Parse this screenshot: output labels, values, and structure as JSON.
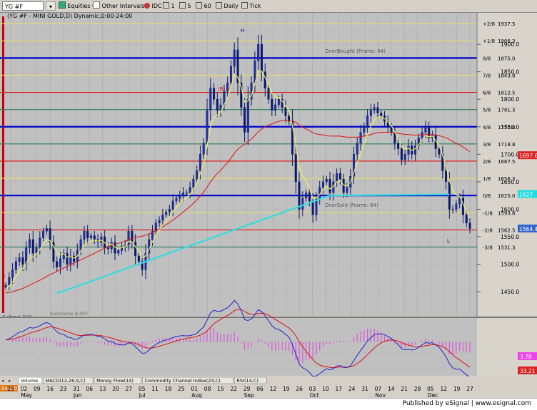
{
  "toolbar": {
    "symbol": "YG #F",
    "equities": "Equities",
    "intervals": "Other Intervals",
    "idc": "IDC",
    "interval_buttons": [
      "1",
      "5",
      "60",
      "Daily",
      "Tick"
    ]
  },
  "chart": {
    "header_title": "(YG #F - MINI GOLD,D) Dynamic,0:00-24:00",
    "copyright": "© eSignal, 2010",
    "autoframe": "AutoFrame is OFF",
    "frame_label_upper": "OverBought (Frame: 64)",
    "frame_label_lower": "OverSold (Frame: 64)",
    "pivot_labels": [
      {
        "text": "(R)",
        "color": "#cc0000"
      },
      {
        "text": "H",
        "color": "#000080"
      },
      {
        "text": "L",
        "color": "#000080"
      },
      {
        "text": "2",
        "color": "#cc0000"
      }
    ],
    "date_box": "04/12/11",
    "published": "Published by eSignal | www.esignal.com"
  },
  "murrey_levels": [
    {
      "label": "+2/8",
      "price": 1937.5,
      "color": "#e8e060"
    },
    {
      "label": "+1/8",
      "price": 1906.3,
      "color": "#e8e060"
    },
    {
      "label": "8/8",
      "price": 1875.0,
      "color": "#0000cc"
    },
    {
      "label": "7/8",
      "price": 1843.8,
      "color": "#e8e060"
    },
    {
      "label": "6/8",
      "price": 1812.5,
      "color": "#dd1111"
    },
    {
      "label": "5/8",
      "price": 1781.3,
      "color": "#2e7d5a"
    },
    {
      "label": "4/8",
      "price": 1750.0,
      "color": "#0000cc"
    },
    {
      "label": "3/8",
      "price": 1718.8,
      "color": "#2e7d5a"
    },
    {
      "label": "2/8",
      "price": 1687.5,
      "color": "#dd1111"
    },
    {
      "label": "1/8",
      "price": 1656.3,
      "color": "#e8e060"
    },
    {
      "label": "0/8",
      "price": 1625.0,
      "color": "#0000cc"
    },
    {
      "label": "-1/8",
      "price": 1593.8,
      "color": "#e8e060"
    },
    {
      "label": "-2/8",
      "price": 1562.5,
      "color": "#dd1111"
    },
    {
      "label": "-3/8",
      "price": 1531.3,
      "color": "#2e7d5a"
    }
  ],
  "price_axis": [
    "1900.0",
    "1850.0",
    "1800.0",
    "1750.0",
    "1700.0",
    "1650.0",
    "1600.0",
    "1550.0",
    "1500.0",
    "1450.0"
  ],
  "current_price_tags": [
    {
      "text": "1697.6",
      "color": "#dd2222"
    },
    {
      "text": "1627",
      "color": "#22dddd"
    },
    {
      "text": "1564.4",
      "color": "#3366cc"
    }
  ],
  "macd_tags": [
    {
      "text": "3.78",
      "color": "#ee44ee"
    },
    {
      "text": "33.21",
      "color": "#dd2222"
    }
  ],
  "tabs": [
    "Volume",
    "MACD(12,26,9,C)",
    "Money Flow(14)",
    "Commodity Channel Index(23,C)",
    "RSI(14,C)"
  ],
  "chart_data": {
    "type": "candlestick",
    "title": "(YG #F - MINI GOLD,D) Dynamic,0:00-24:00",
    "ylim": [
      1410,
      1952
    ],
    "x_ticks": [
      "25",
      "02",
      "09",
      "16",
      "23",
      "31",
      "06",
      "13",
      "20",
      "27",
      "05",
      "11",
      "18",
      "25",
      "01",
      "08",
      "15",
      "22",
      "29",
      "06",
      "12",
      "19",
      "26",
      "03",
      "10",
      "17",
      "24",
      "31",
      "07",
      "14",
      "21",
      "28",
      "05",
      "12",
      "19",
      "27"
    ],
    "months": [
      "May",
      "Jun",
      "Jul",
      "Aug",
      "Sep",
      "Oct",
      "Nov",
      "Dec"
    ],
    "closes": [
      1462,
      1476,
      1490,
      1505,
      1512,
      1500,
      1530,
      1545,
      1520,
      1530,
      1548,
      1560,
      1565,
      1540,
      1505,
      1495,
      1510,
      1520,
      1500,
      1515,
      1505,
      1525,
      1545,
      1560,
      1548,
      1552,
      1545,
      1540,
      1550,
      1530,
      1528,
      1540,
      1520,
      1525,
      1532,
      1535,
      1560,
      1540,
      1515,
      1505,
      1490,
      1520,
      1545,
      1560,
      1575,
      1580,
      1590,
      1595,
      1600,
      1615,
      1620,
      1625,
      1630,
      1630,
      1640,
      1655,
      1670,
      1700,
      1720,
      1780,
      1820,
      1800,
      1780,
      1790,
      1815,
      1830,
      1860,
      1890,
      1830,
      1785,
      1740,
      1800,
      1830,
      1870,
      1900,
      1850,
      1820,
      1800,
      1780,
      1790,
      1800,
      1785,
      1770,
      1760,
      1700,
      1650,
      1600,
      1620,
      1630,
      1615,
      1590,
      1620,
      1640,
      1650,
      1655,
      1630,
      1650,
      1665,
      1655,
      1630,
      1640,
      1660,
      1700,
      1720,
      1740,
      1750,
      1770,
      1780,
      1785,
      1775,
      1770,
      1760,
      1750,
      1740,
      1720,
      1710,
      1690,
      1700,
      1715,
      1700,
      1715,
      1730,
      1740,
      1750,
      1730,
      1735,
      1710,
      1700,
      1670,
      1650,
      1600,
      1600,
      1610,
      1620,
      1590,
      1575,
      1565
    ],
    "ema_red": [
      1448,
      1449,
      1450,
      1452,
      1454,
      1456,
      1459,
      1462,
      1465,
      1468,
      1471,
      1474,
      1478,
      1481,
      1484,
      1487,
      1490,
      1493,
      1496,
      1499,
      1502,
      1505,
      1508,
      1511,
      1514,
      1517,
      1520,
      1523,
      1526,
      1529,
      1532,
      1534,
      1536,
      1538,
      1540,
      1542,
      1545,
      1547,
      1549,
      1550,
      1551,
      1553,
      1555,
      1558,
      1561,
      1564,
      1568,
      1572,
      1576,
      1580,
      1585,
      1590,
      1595,
      1600,
      1605,
      1611,
      1617,
      1624,
      1631,
      1640,
      1650,
      1658,
      1665,
      1671,
      1678,
      1685,
      1693,
      1702,
      1709,
      1714,
      1718,
      1723,
      1728,
      1734,
      1741,
      1746,
      1750,
      1753,
      1755,
      1758,
      1760,
      1761,
      1762,
      1762,
      1761,
      1758,
      1753,
      1749,
      1746,
      1743,
      1739,
      1737,
      1736,
      1735,
      1734,
      1733,
      1733,
      1733,
      1733,
      1732,
      1731,
      1731,
      1731,
      1731,
      1732,
      1733,
      1734,
      1736,
      1738,
      1739,
      1740,
      1740,
      1740,
      1740,
      1739,
      1738,
      1737,
      1736,
      1736,
      1735,
      1735,
      1735,
      1735,
      1736,
      1736,
      1736,
      1735,
      1734,
      1732,
      1730,
      1727,
      1723,
      1720,
      1717,
      1713,
      1709,
      1705
    ],
    "ema_yellow": [
      1455,
      1460,
      1468,
      1478,
      1488,
      1492,
      1502,
      1512,
      1513,
      1518,
      1527,
      1537,
      1545,
      1543,
      1532,
      1522,
      1518,
      1519,
      1513,
      1514,
      1511,
      1515,
      1524,
      1535,
      1539,
      1543,
      1544,
      1542,
      1544,
      1539,
      1535,
      1537,
      1531,
      1529,
      1530,
      1532,
      1542,
      1541,
      1532,
      1523,
      1512,
      1515,
      1527,
      1541,
      1553,
      1562,
      1571,
      1579,
      1586,
      1596,
      1604,
      1611,
      1617,
      1621,
      1627,
      1636,
      1647,
      1665,
      1683,
      1715,
      1750,
      1767,
      1771,
      1777,
      1790,
      1803,
      1822,
      1845,
      1840,
      1822,
      1795,
      1797,
      1807,
      1828,
      1852,
      1851,
      1840,
      1827,
      1811,
      1804,
      1803,
      1797,
      1788,
      1779,
      1752,
      1716,
      1677,
      1660,
      1651,
      1638,
      1620,
      1620,
      1627,
      1635,
      1642,
      1637,
      1641,
      1650,
      1652,
      1644,
      1643,
      1649,
      1667,
      1685,
      1703,
      1719,
      1737,
      1751,
      1763,
      1767,
      1768,
      1765,
      1759,
      1752,
      1740,
      1729,
      1714,
      1709,
      1711,
      1707,
      1710,
      1717,
      1725,
      1734,
      1732,
      1733,
      1725,
      1716,
      1698,
      1680,
      1652,
      1634,
      1626,
      1624,
      1610,
      1596,
      1584
    ],
    "ma_cyan_points": [
      [
        1447,
        15
      ],
      [
        1625,
        95
      ],
      [
        1627,
        130
      ]
    ],
    "macd_range": [
      -60,
      40
    ]
  }
}
